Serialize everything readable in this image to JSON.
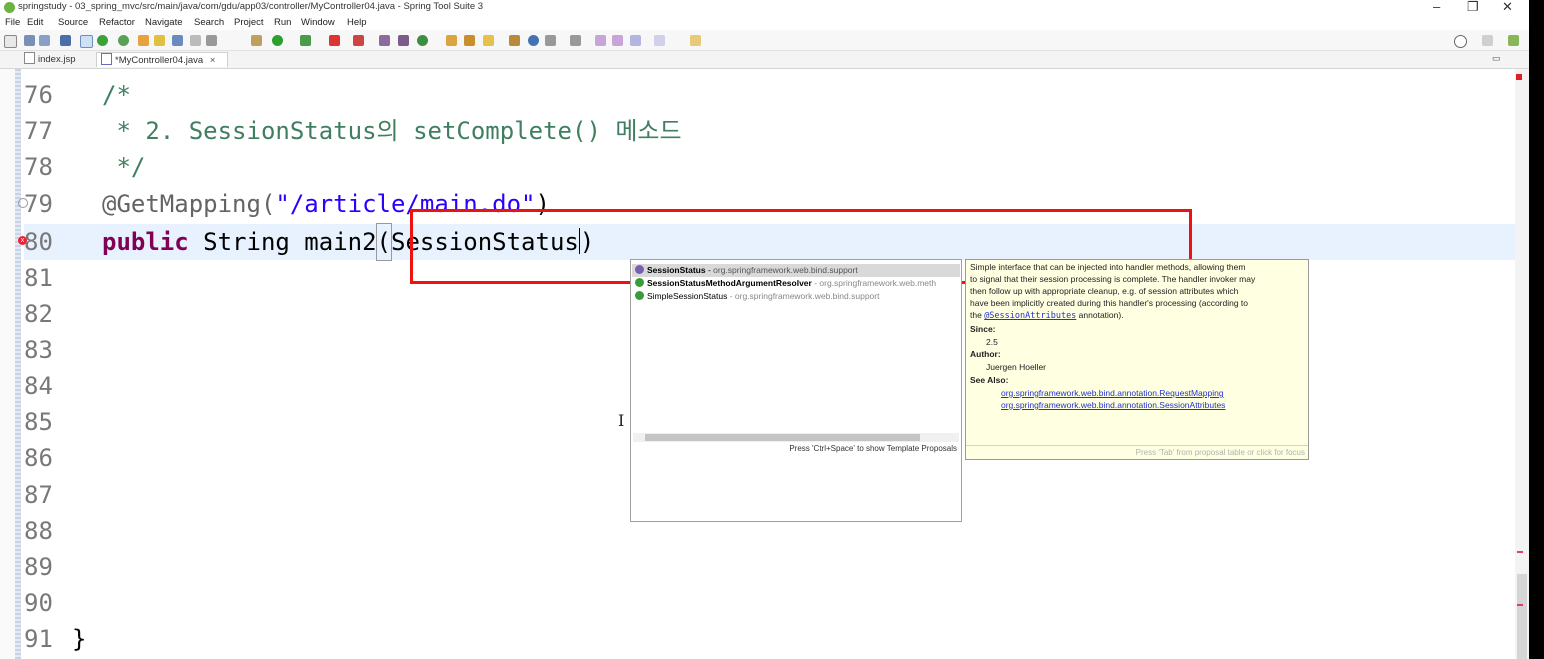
{
  "window": {
    "title": "springstudy - 03_spring_mvc/src/main/java/com/gdu/app03/controller/MyController04.java - Spring Tool Suite 3",
    "minimize": "–",
    "restore": "❐",
    "close": "✕"
  },
  "menu": [
    "File",
    "Edit",
    "Source",
    "Refactor",
    "Navigate",
    "Search",
    "Project",
    "Run",
    "Window",
    "Help"
  ],
  "tabs": [
    {
      "label": "index.jsp",
      "active": false
    },
    {
      "label": "*MyController04.java",
      "active": true,
      "close": "×"
    }
  ],
  "editor": {
    "line_numbers": [
      "76",
      "77",
      "78",
      "79",
      "80",
      "81",
      "82",
      "83",
      "84",
      "85",
      "86",
      "87",
      "88",
      "89",
      "90",
      "91"
    ],
    "lines": {
      "l76": "/*",
      "l77": " * 2. SessionStatus의 setComplete() 메소드",
      "l78": " */",
      "l79_ann": "@GetMapping(",
      "l79_str": "\"/article/main.do\"",
      "l79_end": ")",
      "l80_kw": "public",
      "l80_rest": " String main2",
      "l80_open": "(",
      "l80_typed": "SessionStatus",
      "l80_close": ")",
      "l91": "}"
    },
    "current_line": "80",
    "error_line": "80",
    "override_line": "79"
  },
  "content_assist": {
    "items": [
      {
        "name": "SessionStatus",
        "sep": " - ",
        "package": "org.springframework.web.bind.support",
        "icon": "interface-icon",
        "selected": true
      },
      {
        "name": "SessionStatusMethodArgumentResolver",
        "sep": " - ",
        "package": "org.springframework.web.meth",
        "icon": "class-icon",
        "selected": false
      },
      {
        "name": "SimpleSessionStatus",
        "sep": " - ",
        "package": "org.springframework.web.bind.support",
        "icon": "class-icon",
        "selected": false
      }
    ],
    "status": "Press 'Ctrl+Space' to show Template Proposals"
  },
  "javadoc": {
    "desc_1": "Simple interface that can be injected into handler methods, allowing them",
    "desc_2": "to signal that their session processing is complete. The handler invoker may",
    "desc_3": "then follow up with appropriate cleanup, e.g. of session attributes which",
    "desc_4": "have been implicitly created during this handler's processing (according to",
    "desc_5_pre": "the ",
    "desc_5_link": "@SessionAttributes",
    "desc_5_post": " annotation).",
    "since_label": "Since:",
    "since_value": "2.5",
    "author_label": "Author:",
    "author_value": "Juergen Hoeller",
    "see_also_label": "See Also:",
    "see_also": [
      "org.springframework.web.bind.annotation.RequestMapping",
      "org.springframework.web.bind.annotation.SessionAttributes"
    ],
    "footer": "Press 'Tab' from proposal table or click for focus"
  },
  "colors": {
    "highlight_box": "#ee1111",
    "current_line": "#e8f2fe",
    "javadoc_bg": "#ffffe1"
  }
}
